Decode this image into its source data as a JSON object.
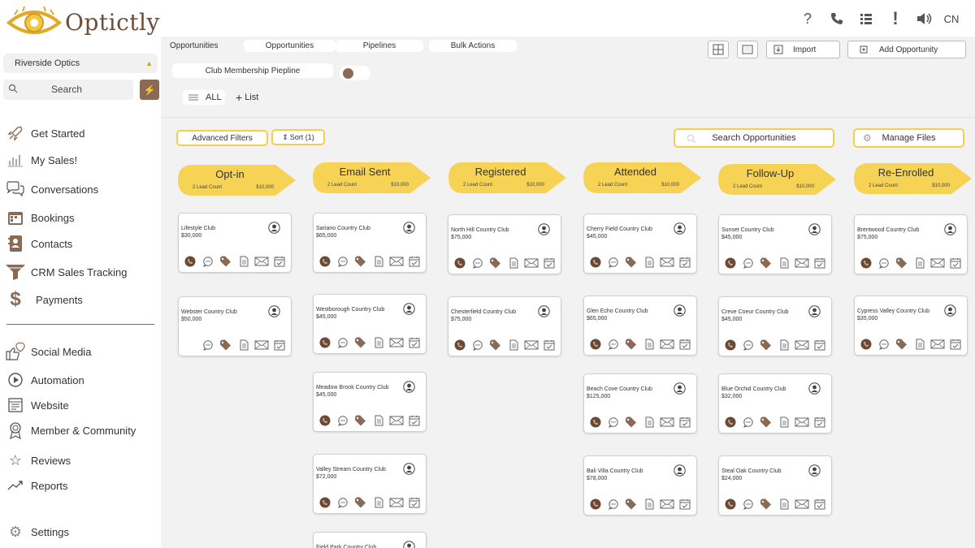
{
  "app": {
    "name": "Optictly",
    "lang": "CN"
  },
  "header_icons": [
    "help-icon",
    "phone-icon",
    "list-icon",
    "alert-icon",
    "speaker-icon"
  ],
  "sidebar": {
    "account": "Riverside Optics",
    "search_label": "Search",
    "items": [
      {
        "label": "Get Started",
        "icon": "rocket-icon"
      },
      {
        "label": "My Sales!",
        "icon": "bar-chart-icon"
      },
      {
        "label": "Conversations",
        "icon": "chat-icon"
      },
      {
        "label": "Bookings",
        "icon": "calendar-icon"
      },
      {
        "label": "Contacts",
        "icon": "contacts-icon"
      },
      {
        "label": "CRM Sales Tracking",
        "icon": "funnel-icon"
      },
      {
        "label": "Payments",
        "icon": "dollar-icon"
      },
      {
        "label": "Social Media",
        "icon": "like-icon"
      },
      {
        "label": "Automation",
        "icon": "play-icon"
      },
      {
        "label": "Website",
        "icon": "website-icon"
      },
      {
        "label": "Member & Community",
        "icon": "badge-icon"
      },
      {
        "label": "Reviews",
        "icon": "star-icon"
      },
      {
        "label": "Reports",
        "icon": "trend-icon"
      },
      {
        "label": "Settings",
        "icon": "gear-icon"
      }
    ]
  },
  "toolbar": {
    "section_label": "Opportunities",
    "tabs": [
      "Opportunities",
      "Pipelines",
      "Bulk Actions"
    ],
    "pipeline": "Club Membership Piepline",
    "import_label": "Import",
    "add_label": "Add Opportunity",
    "all_label": "ALL",
    "list_label": "List",
    "advanced_filters": "Advanced Filters",
    "sort_label": "Sort (1)",
    "search_placeholder": "Search Opportunities",
    "manage_files": "Manage Files"
  },
  "stages": [
    {
      "name": "Opt-in",
      "count": "2 Lead Count",
      "value": "$10,000",
      "cards": [
        {
          "name": "Lifestyle Club",
          "amount": "$30,000",
          "phone": true
        },
        {
          "name": "Webster Country Club",
          "amount": "$50,000",
          "phone": false
        }
      ]
    },
    {
      "name": "Email Sent",
      "count": "2 Lead Count",
      "value": "$10,000",
      "cards": [
        {
          "name": "Sariano Country Club",
          "amount": "$65,000",
          "phone": true
        },
        {
          "name": "Westborough Country Club",
          "amount": "$45,000",
          "phone": true
        },
        {
          "name": "Meadow Brook Country Club",
          "amount": "$45,000",
          "phone": true
        },
        {
          "name": "Valley Stream Country Club",
          "amount": "$72,000",
          "phone": true
        },
        {
          "name": "Field Park Country Club",
          "amount": "",
          "phone": true
        }
      ]
    },
    {
      "name": "Registered",
      "count": "2 Lead Count",
      "value": "$10,000",
      "cards": [
        {
          "name": "North Hill Country Club",
          "amount": "$75,000",
          "phone": true
        },
        {
          "name": "Chesterfield Country Club",
          "amount": "$75,000",
          "phone": true
        }
      ]
    },
    {
      "name": "Attended",
      "count": "2 Lead Count",
      "value": "$10,000",
      "cards": [
        {
          "name": "Cherry Field Country Club",
          "amount": "$45,000",
          "phone": true
        },
        {
          "name": "Glen Echo Country Club",
          "amount": "$65,000",
          "phone": true
        },
        {
          "name": "Beach Cove Country Club",
          "amount": "$125,000",
          "phone": true
        },
        {
          "name": "Bali Villa Country Club",
          "amount": "$78,000",
          "phone": true
        }
      ]
    },
    {
      "name": "Follow-Up",
      "count": "2 Lead Count",
      "value": "$10,000",
      "cards": [
        {
          "name": "Sunset Country Club",
          "amount": "$45,000",
          "phone": true
        },
        {
          "name": "Creve Coeur Country Club",
          "amount": "$45,000",
          "phone": true
        },
        {
          "name": "Blue Orchid Country Club",
          "amount": "$32,000",
          "phone": true
        },
        {
          "name": "Steal Oak Country Club",
          "amount": "$24,000",
          "phone": true
        }
      ]
    },
    {
      "name": "Re-Enrolled",
      "count": "2 Lead Count",
      "value": "$10,000",
      "cards": [
        {
          "name": "Brentwood Country Club",
          "amount": "$75,000",
          "phone": true
        },
        {
          "name": "Cypress Valley Country Club",
          "amount": "$35,000",
          "phone": true
        }
      ]
    }
  ],
  "colors": {
    "brown": "#8a6a55",
    "gold": "#f6d355",
    "gold_border": "#f3cf4c"
  }
}
